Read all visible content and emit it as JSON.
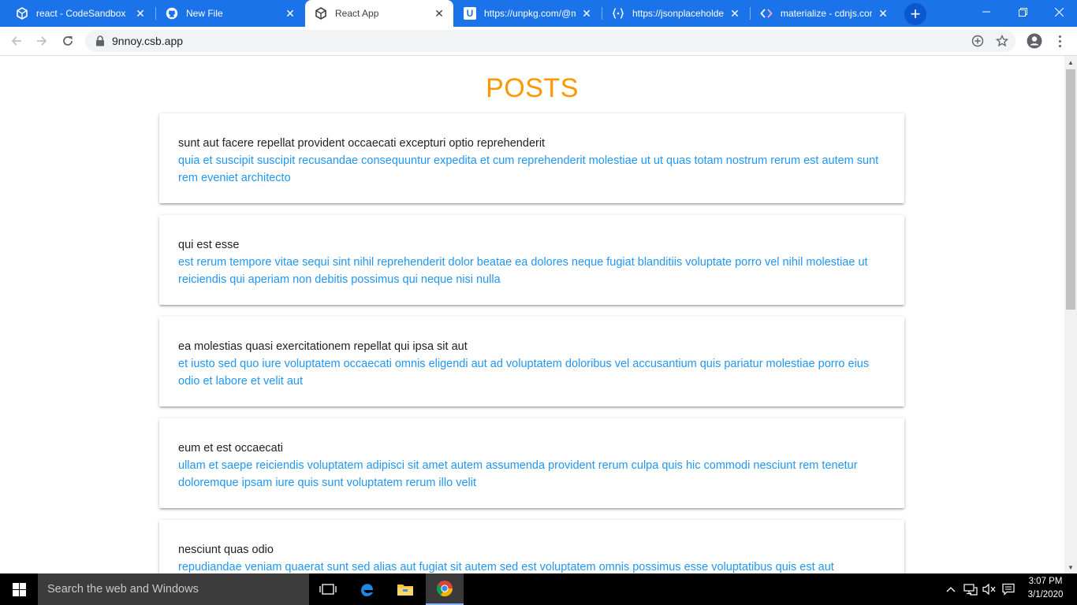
{
  "browser": {
    "tabs": [
      {
        "title": "react - CodeSandbox",
        "icon": "codesandbox-icon",
        "active": false
      },
      {
        "title": "New File",
        "icon": "github-icon",
        "active": false
      },
      {
        "title": "React App",
        "icon": "codesandbox-icon",
        "active": true
      },
      {
        "title": "https://unpkg.com/@m",
        "icon": "unpkg-icon",
        "active": false
      },
      {
        "title": "https://jsonplaceholder",
        "icon": "jsonplaceholder-icon",
        "active": false
      },
      {
        "title": "materialize - cdnjs.com",
        "icon": "cdnjs-icon",
        "active": false
      }
    ],
    "new_tab_label": "+",
    "address": "9nnoy.csb.app",
    "accent": "#1a73e8"
  },
  "page": {
    "title": "POSTS",
    "title_color": "#ff9800",
    "body_color": "#2196f3",
    "posts": [
      {
        "title": "sunt aut facere repellat provident occaecati excepturi optio reprehenderit",
        "body": "quia et suscipit suscipit recusandae consequuntur expedita et cum reprehenderit molestiae ut ut quas totam nostrum rerum est autem sunt rem eveniet architecto"
      },
      {
        "title": "qui est esse",
        "body": "est rerum tempore vitae sequi sint nihil reprehenderit dolor beatae ea dolores neque fugiat blanditiis voluptate porro vel nihil molestiae ut reiciendis qui aperiam non debitis possimus qui neque nisi nulla"
      },
      {
        "title": "ea molestias quasi exercitationem repellat qui ipsa sit aut",
        "body": "et iusto sed quo iure voluptatem occaecati omnis eligendi aut ad voluptatem doloribus vel accusantium quis pariatur molestiae porro eius odio et labore et velit aut"
      },
      {
        "title": "eum et est occaecati",
        "body": "ullam et saepe reiciendis voluptatem adipisci sit amet autem assumenda provident rerum culpa quis hic commodi nesciunt rem tenetur doloremque ipsam iure quis sunt voluptatem rerum illo velit"
      },
      {
        "title": "nesciunt quas odio",
        "body": "repudiandae veniam quaerat sunt sed alias aut fugiat sit autem sed est voluptatem omnis possimus esse voluptatibus quis est aut"
      }
    ]
  },
  "taskbar": {
    "search_placeholder": "Search the web and Windows",
    "apps": [
      "task-view-icon",
      "edge-icon",
      "file-explorer-icon",
      "chrome-icon"
    ],
    "time": "3:07 PM",
    "date": "3/1/2020"
  }
}
